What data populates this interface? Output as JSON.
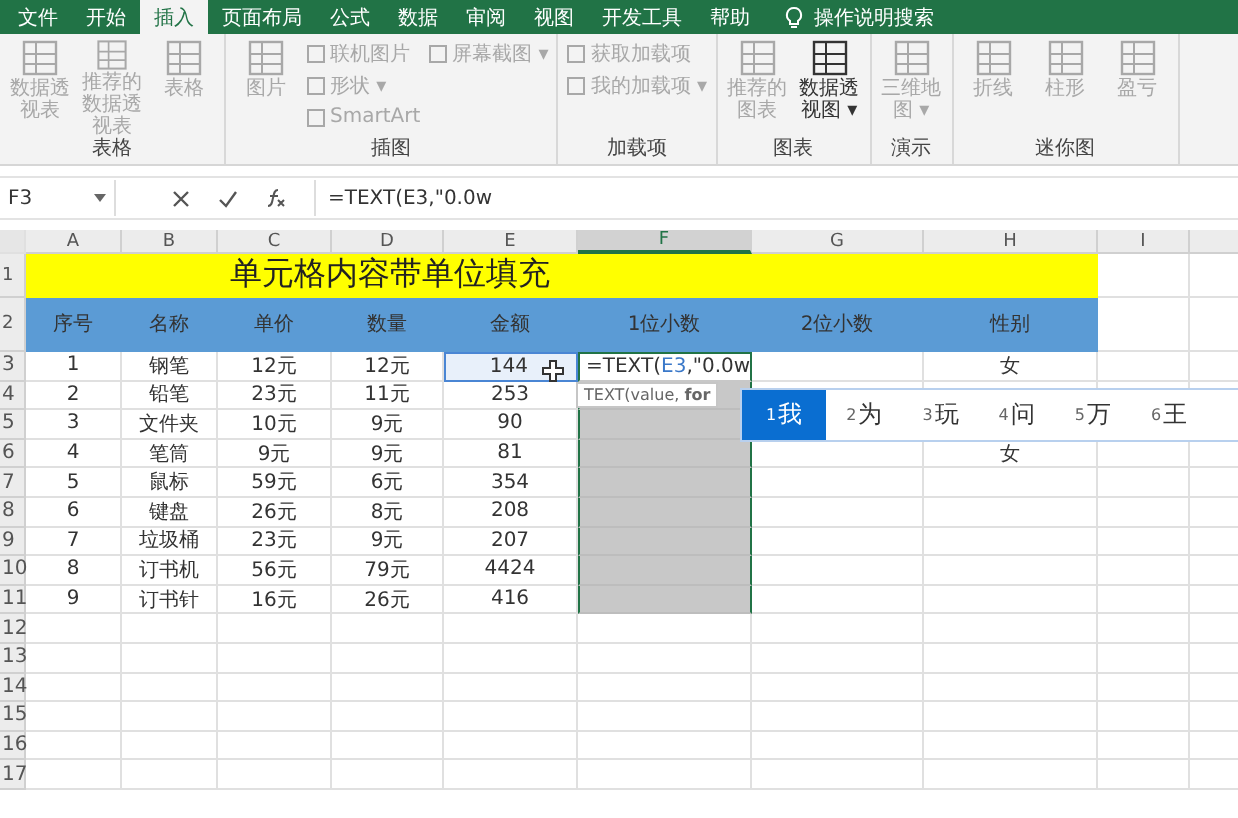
{
  "menu_tabs": [
    {
      "label": "文件",
      "selected": false
    },
    {
      "label": "开始",
      "selected": false
    },
    {
      "label": "插入",
      "selected": true
    },
    {
      "label": "页面布局",
      "selected": false
    },
    {
      "label": "公式",
      "selected": false
    },
    {
      "label": "数据",
      "selected": false
    },
    {
      "label": "审阅",
      "selected": false
    },
    {
      "label": "视图",
      "selected": false
    },
    {
      "label": "开发工具",
      "selected": false
    },
    {
      "label": "帮助",
      "selected": false
    }
  ],
  "tell_me": "操作说明搜索",
  "ribbon_groups": [
    {
      "label": "表格",
      "items": [
        {
          "label": "数据透视表",
          "kind": "large",
          "disabled": true
        },
        {
          "label": "推荐的数据透视表",
          "kind": "large",
          "disabled": true
        },
        {
          "label": "表格",
          "kind": "large",
          "disabled": true
        }
      ]
    },
    {
      "label": "插图",
      "items": [
        {
          "label": "图片",
          "kind": "large",
          "disabled": true
        },
        {
          "label": "联机图片",
          "kind": "small",
          "disabled": true
        },
        {
          "label": "形状 ▾",
          "kind": "small",
          "disabled": true
        },
        {
          "label": "SmartArt",
          "kind": "small",
          "disabled": true
        },
        {
          "label": "屏幕截图 ▾",
          "kind": "small",
          "disabled": true
        }
      ]
    },
    {
      "label": "加载项",
      "items": [
        {
          "label": "获取加载项",
          "kind": "small",
          "disabled": true
        },
        {
          "label": "我的加载项 ▾",
          "kind": "small",
          "disabled": true
        }
      ]
    },
    {
      "label": "图表",
      "items": [
        {
          "label": "推荐的图表",
          "kind": "large",
          "disabled": true
        },
        {
          "label": "数据透视图 ▾",
          "kind": "large",
          "disabled": false
        }
      ]
    },
    {
      "label": "演示",
      "items": [
        {
          "label": "三维地图 ▾",
          "kind": "large",
          "disabled": true
        }
      ]
    },
    {
      "label": "迷你图",
      "items": [
        {
          "label": "折线",
          "kind": "large",
          "disabled": true
        },
        {
          "label": "柱形",
          "kind": "large",
          "disabled": true
        },
        {
          "label": "盈亏",
          "kind": "large",
          "disabled": true
        }
      ]
    }
  ],
  "name_box": "F3",
  "formula": "=TEXT(E3,\"0.0w",
  "columns": [
    {
      "label": "A",
      "selected": false
    },
    {
      "label": "B",
      "selected": false
    },
    {
      "label": "C",
      "selected": false
    },
    {
      "label": "D",
      "selected": false
    },
    {
      "label": "E",
      "selected": false
    },
    {
      "label": "F",
      "selected": true
    },
    {
      "label": "G",
      "selected": false
    },
    {
      "label": "H",
      "selected": false
    },
    {
      "label": "I",
      "selected": false
    }
  ],
  "title_row": {
    "row": "1",
    "text": "单元格内容带单位填充"
  },
  "header_row": {
    "row": "2",
    "cells": [
      "序号",
      "名称",
      "单价",
      "数量",
      "金额",
      "1位小数",
      "2位小数",
      "性别"
    ]
  },
  "rows": [
    {
      "row": "3",
      "cells": [
        "1",
        "钢笔",
        "12元",
        "12元",
        "144",
        "",
        "",
        "女"
      ],
      "in_range": true
    },
    {
      "row": "4",
      "cells": [
        "2",
        "铅笔",
        "23元",
        "11元",
        "253",
        "",
        "",
        ""
      ],
      "in_range": true
    },
    {
      "row": "5",
      "cells": [
        "3",
        "文件夹",
        "10元",
        "9元",
        "90",
        "",
        "",
        ""
      ],
      "in_range": true
    },
    {
      "row": "6",
      "cells": [
        "4",
        "笔筒",
        "9元",
        "9元",
        "81",
        "",
        "",
        "女"
      ],
      "in_range": true
    },
    {
      "row": "7",
      "cells": [
        "5",
        "鼠标",
        "59元",
        "6元",
        "354",
        "",
        "",
        ""
      ],
      "in_range": true
    },
    {
      "row": "8",
      "cells": [
        "6",
        "键盘",
        "26元",
        "8元",
        "208",
        "",
        "",
        ""
      ],
      "in_range": true
    },
    {
      "row": "9",
      "cells": [
        "7",
        "垃圾桶",
        "23元",
        "9元",
        "207",
        "",
        "",
        ""
      ],
      "in_range": true
    },
    {
      "row": "10",
      "cells": [
        "8",
        "订书机",
        "56元",
        "79元",
        "4424",
        "",
        "",
        ""
      ],
      "in_range": true
    },
    {
      "row": "11",
      "cells": [
        "9",
        "订书针",
        "16元",
        "26元",
        "416",
        "",
        "",
        ""
      ],
      "in_range": true
    }
  ],
  "empty_rows": [
    "12",
    "13",
    "14",
    "15",
    "16",
    "17"
  ],
  "editing": {
    "prefix": "=TEXT(",
    "ref": "E3",
    "suffix": ",\"0.0w"
  },
  "tooltip": "TEXT(value, **for**",
  "ime_candidates": [
    {
      "index": "1",
      "text": "我",
      "selected": true
    },
    {
      "index": "2",
      "text": "为",
      "selected": false
    },
    {
      "index": "3",
      "text": "玩",
      "selected": false
    },
    {
      "index": "4",
      "text": "问",
      "selected": false
    },
    {
      "index": "5",
      "text": "万",
      "selected": false
    },
    {
      "index": "6",
      "text": "王",
      "selected": false
    }
  ]
}
